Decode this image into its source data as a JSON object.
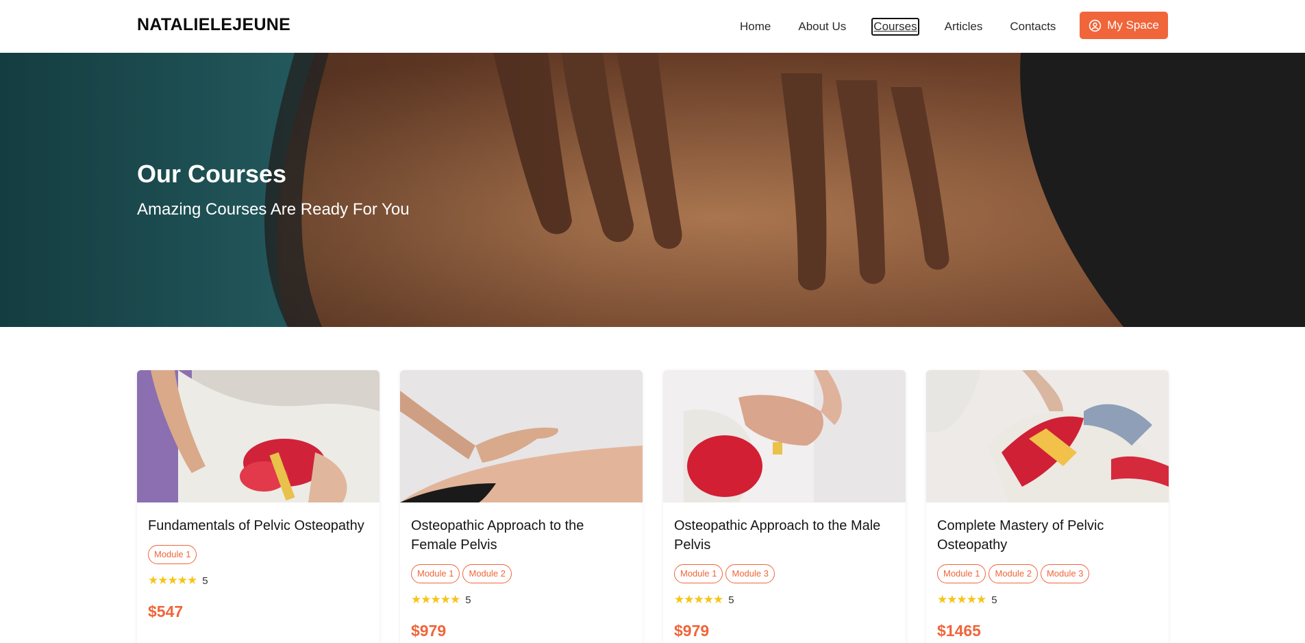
{
  "header": {
    "brand": "NATALIELEJEUNE",
    "nav": [
      {
        "label": "Home"
      },
      {
        "label": "About Us"
      },
      {
        "label": "Courses",
        "active": true
      },
      {
        "label": "Articles"
      },
      {
        "label": "Contacts"
      }
    ],
    "cart_icon": "cart-icon",
    "my_space_label": "My Space",
    "my_space_icon": "user-circle-icon"
  },
  "hero": {
    "title": "Our Courses",
    "subtitle": "Amazing Courses Are Ready For You"
  },
  "courses": [
    {
      "title": "Fundamentals of Pelvic Osteopathy",
      "modules": [
        "Module 1"
      ],
      "rating": "5",
      "stars": "★★★★★",
      "price": "$547"
    },
    {
      "title": "Osteopathic Approach to the Female Pelvis",
      "modules": [
        "Module 1",
        "Module 2"
      ],
      "rating": "5",
      "stars": "★★★★★",
      "price": "$979"
    },
    {
      "title": "Osteopathic Approach to the Male Pelvis",
      "modules": [
        "Module 1",
        "Module 3"
      ],
      "rating": "5",
      "stars": "★★★★★",
      "price": "$979"
    },
    {
      "title": "Complete Mastery of Pelvic Osteopathy",
      "modules": [
        "Module 1",
        "Module 2",
        "Module 3"
      ],
      "rating": "5",
      "stars": "★★★★★",
      "price": "$1465"
    }
  ],
  "colors": {
    "accent": "#f0653a",
    "star": "#f5c518"
  }
}
